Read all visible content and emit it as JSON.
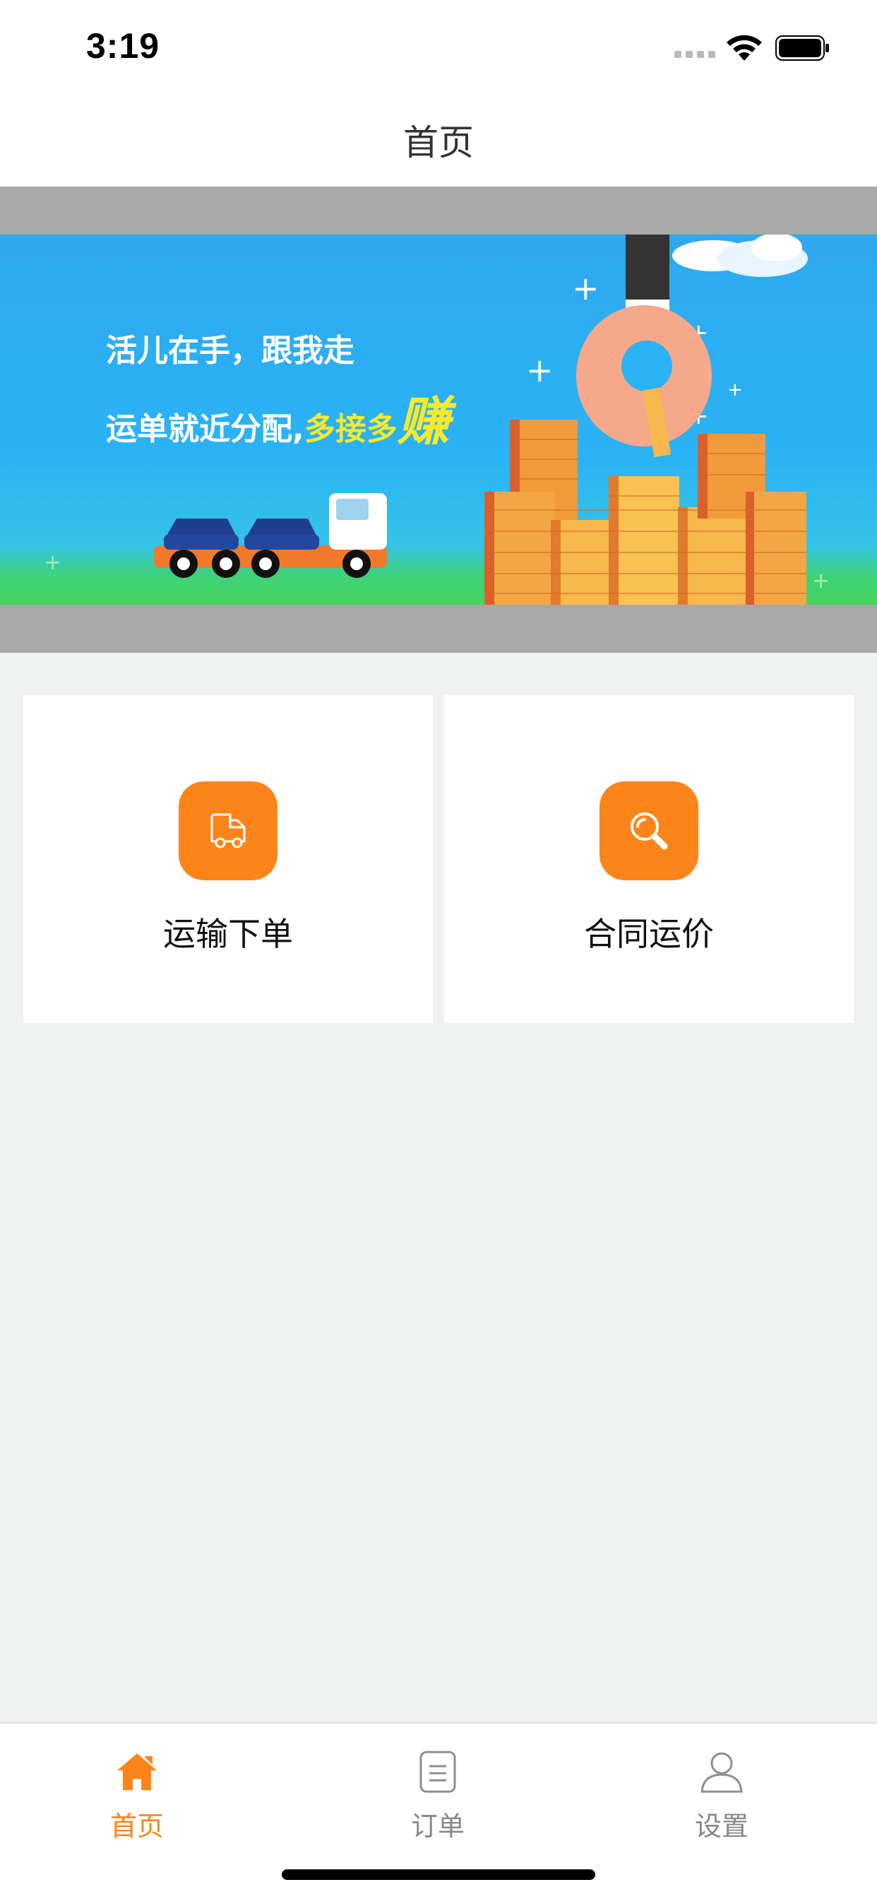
{
  "status_bar": {
    "time": "3:19"
  },
  "nav": {
    "title": "首页"
  },
  "banner": {
    "line1": "活儿在手，跟我走",
    "line2_prefix": "运单就近分配,",
    "line2_highlight": "多接多",
    "line2_big": "赚"
  },
  "cards": [
    {
      "label": "运输下单",
      "icon": "truck-icon"
    },
    {
      "label": "合同运价",
      "icon": "search-icon"
    }
  ],
  "tabs": [
    {
      "label": "首页",
      "icon": "home-icon",
      "active": true
    },
    {
      "label": "订单",
      "icon": "document-icon",
      "active": false
    },
    {
      "label": "设置",
      "icon": "user-icon",
      "active": false
    }
  ],
  "colors": {
    "accent": "#fd8419",
    "background": "#f0f2f1",
    "inactive": "#888888"
  }
}
